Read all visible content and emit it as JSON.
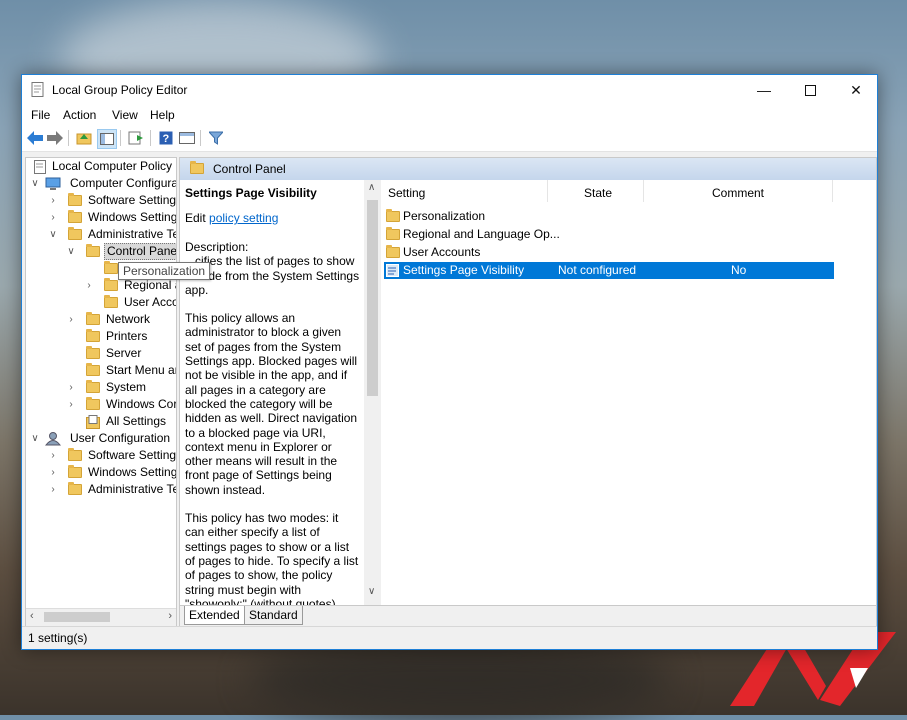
{
  "window": {
    "title": "Local Group Policy Editor"
  },
  "menu": [
    "File",
    "Action",
    "View",
    "Help"
  ],
  "tree": {
    "nodes": [
      {
        "label": "Local Computer Policy"
      },
      {
        "label": "Computer Configura"
      },
      {
        "label": "Software Settings"
      },
      {
        "label": "Windows Setting"
      },
      {
        "label": "Administrative Te"
      },
      {
        "label": "Control Panel"
      },
      {
        "label": ""
      },
      {
        "label": "Regional a"
      },
      {
        "label": "User Acco"
      },
      {
        "label": "Network"
      },
      {
        "label": "Printers"
      },
      {
        "label": "Server"
      },
      {
        "label": "Start Menu ar"
      },
      {
        "label": "System"
      },
      {
        "label": "Windows Cor"
      },
      {
        "label": "All Settings"
      },
      {
        "label": "User Configuration"
      },
      {
        "label": "Software Settings"
      },
      {
        "label": "Windows Setting"
      },
      {
        "label": "Administrative Te"
      }
    ],
    "tooltip": "Personalization"
  },
  "header": {
    "folder": "Control Panel"
  },
  "description": {
    "title": "Settings Page Visibility",
    "edit_prefix": "Edit",
    "edit_link": "policy setting",
    "label": "Description:",
    "p1": "...cifies the list of pages to show or hide from the System Settings app.",
    "p2": "This policy allows an administrator to block a given set of pages from the System Settings app. Blocked pages will not be visible in the app, and if all pages in a category are blocked the category will be hidden as well. Direct navigation to a blocked page via URI, context menu in Explorer or other means will result in the front page of Settings being shown instead.",
    "p3": "This policy has two modes: it can either specify a list of settings pages to show or a list of pages to hide. To specify a list of pages to show, the policy string must begin with \"showonly:\" (without quotes), and to specify a list of"
  },
  "list": {
    "columns": [
      "Setting",
      "State",
      "Comment"
    ],
    "rows": [
      {
        "setting": "Personalization",
        "state": "",
        "comment": ""
      },
      {
        "setting": "Regional and Language Op...",
        "state": "",
        "comment": ""
      },
      {
        "setting": "User Accounts",
        "state": "",
        "comment": ""
      },
      {
        "setting": "Settings Page Visibility",
        "state": "Not configured",
        "comment": "No"
      }
    ]
  },
  "tabs": [
    "Extended",
    "Standard"
  ],
  "status": "1 setting(s)",
  "colors": {
    "accent": "#0078d7",
    "header_bg": "#c5d6ec",
    "folder": "#f0c75e",
    "logo_red": "#e3262b"
  }
}
